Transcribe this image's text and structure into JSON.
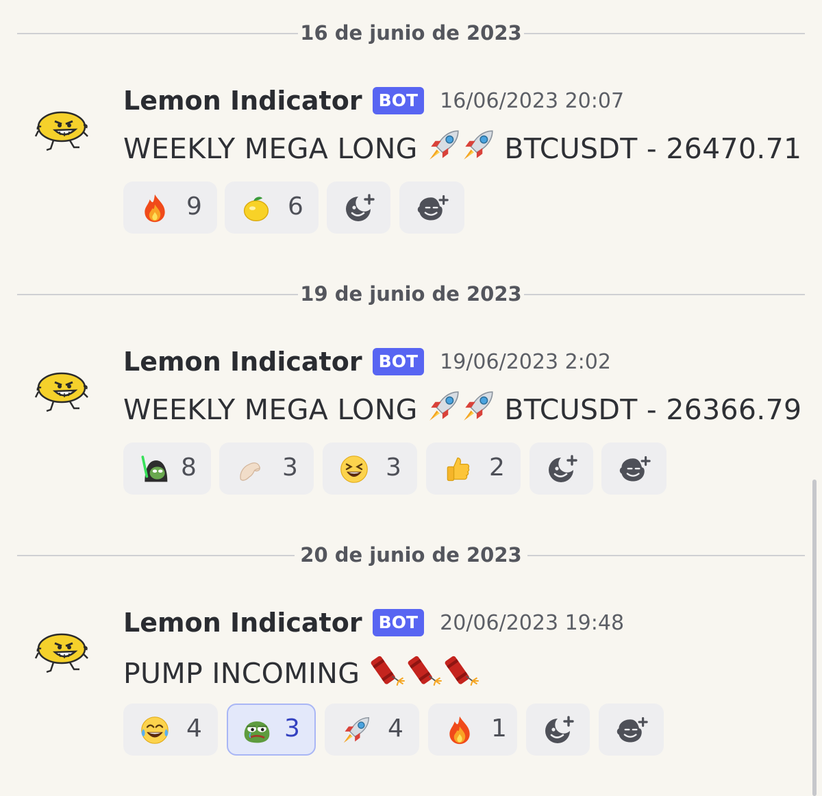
{
  "app": {
    "accent": "#5865f2",
    "background": "#f8f6f0"
  },
  "messages": [
    {
      "date_divider": "16 de junio de 2023",
      "author": "Lemon Indicator",
      "badge": "BOT",
      "timestamp": "16/06/2023 20:07",
      "text_prefix": "WEEKLY MEGA LONG",
      "text_suffix": "BTCUSDT - 26470.71",
      "text_emojis": [
        "rocket-emoji",
        "rocket-emoji"
      ],
      "reactions": [
        {
          "emoji": "fire-emoji",
          "count": "9"
        },
        {
          "emoji": "lemon-emoji",
          "count": "6"
        }
      ]
    },
    {
      "date_divider": "19 de junio de 2023",
      "author": "Lemon Indicator",
      "badge": "BOT",
      "timestamp": "19/06/2023 2:02",
      "text_prefix": "WEEKLY MEGA LONG",
      "text_suffix": "BTCUSDT - 26366.79",
      "text_emojis": [
        "rocket-emoji",
        "rocket-emoji"
      ],
      "reactions": [
        {
          "emoji": "pepe-jedi-emoji",
          "count": "8"
        },
        {
          "emoji": "pinching-hand-emoji",
          "count": "3"
        },
        {
          "emoji": "laughing-squint-emoji",
          "count": "3"
        },
        {
          "emoji": "thumbs-up-emoji",
          "count": "2"
        }
      ]
    },
    {
      "date_divider": "20 de junio de 2023",
      "author": "Lemon Indicator",
      "badge": "BOT",
      "timestamp": "20/06/2023 19:48",
      "text_prefix": "PUMP INCOMING",
      "text_suffix": "",
      "text_emojis": [
        "firecracker-emoji",
        "firecracker-emoji",
        "firecracker-emoji"
      ],
      "reactions": [
        {
          "emoji": "tears-of-joy-emoji",
          "count": "4"
        },
        {
          "emoji": "pepe-sad-emoji",
          "count": "3",
          "active": true
        },
        {
          "emoji": "rocket-emoji",
          "count": "4"
        },
        {
          "emoji": "fire-emoji",
          "count": "1"
        }
      ]
    }
  ],
  "actions": {
    "add_reaction_icon": "add-reaction-icon",
    "add_super_reaction_icon": "add-super-reaction-icon"
  }
}
